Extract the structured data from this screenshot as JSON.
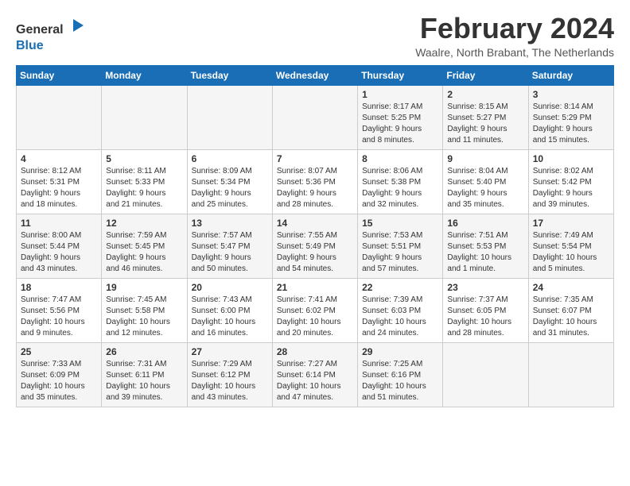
{
  "logo": {
    "line1": "General",
    "line2": "Blue"
  },
  "title": "February 2024",
  "location": "Waalre, North Brabant, The Netherlands",
  "weekdays": [
    "Sunday",
    "Monday",
    "Tuesday",
    "Wednesday",
    "Thursday",
    "Friday",
    "Saturday"
  ],
  "weeks": [
    [
      {
        "day": "",
        "info": ""
      },
      {
        "day": "",
        "info": ""
      },
      {
        "day": "",
        "info": ""
      },
      {
        "day": "",
        "info": ""
      },
      {
        "day": "1",
        "info": "Sunrise: 8:17 AM\nSunset: 5:25 PM\nDaylight: 9 hours\nand 8 minutes."
      },
      {
        "day": "2",
        "info": "Sunrise: 8:15 AM\nSunset: 5:27 PM\nDaylight: 9 hours\nand 11 minutes."
      },
      {
        "day": "3",
        "info": "Sunrise: 8:14 AM\nSunset: 5:29 PM\nDaylight: 9 hours\nand 15 minutes."
      }
    ],
    [
      {
        "day": "4",
        "info": "Sunrise: 8:12 AM\nSunset: 5:31 PM\nDaylight: 9 hours\nand 18 minutes."
      },
      {
        "day": "5",
        "info": "Sunrise: 8:11 AM\nSunset: 5:33 PM\nDaylight: 9 hours\nand 21 minutes."
      },
      {
        "day": "6",
        "info": "Sunrise: 8:09 AM\nSunset: 5:34 PM\nDaylight: 9 hours\nand 25 minutes."
      },
      {
        "day": "7",
        "info": "Sunrise: 8:07 AM\nSunset: 5:36 PM\nDaylight: 9 hours\nand 28 minutes."
      },
      {
        "day": "8",
        "info": "Sunrise: 8:06 AM\nSunset: 5:38 PM\nDaylight: 9 hours\nand 32 minutes."
      },
      {
        "day": "9",
        "info": "Sunrise: 8:04 AM\nSunset: 5:40 PM\nDaylight: 9 hours\nand 35 minutes."
      },
      {
        "day": "10",
        "info": "Sunrise: 8:02 AM\nSunset: 5:42 PM\nDaylight: 9 hours\nand 39 minutes."
      }
    ],
    [
      {
        "day": "11",
        "info": "Sunrise: 8:00 AM\nSunset: 5:44 PM\nDaylight: 9 hours\nand 43 minutes."
      },
      {
        "day": "12",
        "info": "Sunrise: 7:59 AM\nSunset: 5:45 PM\nDaylight: 9 hours\nand 46 minutes."
      },
      {
        "day": "13",
        "info": "Sunrise: 7:57 AM\nSunset: 5:47 PM\nDaylight: 9 hours\nand 50 minutes."
      },
      {
        "day": "14",
        "info": "Sunrise: 7:55 AM\nSunset: 5:49 PM\nDaylight: 9 hours\nand 54 minutes."
      },
      {
        "day": "15",
        "info": "Sunrise: 7:53 AM\nSunset: 5:51 PM\nDaylight: 9 hours\nand 57 minutes."
      },
      {
        "day": "16",
        "info": "Sunrise: 7:51 AM\nSunset: 5:53 PM\nDaylight: 10 hours\nand 1 minute."
      },
      {
        "day": "17",
        "info": "Sunrise: 7:49 AM\nSunset: 5:54 PM\nDaylight: 10 hours\nand 5 minutes."
      }
    ],
    [
      {
        "day": "18",
        "info": "Sunrise: 7:47 AM\nSunset: 5:56 PM\nDaylight: 10 hours\nand 9 minutes."
      },
      {
        "day": "19",
        "info": "Sunrise: 7:45 AM\nSunset: 5:58 PM\nDaylight: 10 hours\nand 12 minutes."
      },
      {
        "day": "20",
        "info": "Sunrise: 7:43 AM\nSunset: 6:00 PM\nDaylight: 10 hours\nand 16 minutes."
      },
      {
        "day": "21",
        "info": "Sunrise: 7:41 AM\nSunset: 6:02 PM\nDaylight: 10 hours\nand 20 minutes."
      },
      {
        "day": "22",
        "info": "Sunrise: 7:39 AM\nSunset: 6:03 PM\nDaylight: 10 hours\nand 24 minutes."
      },
      {
        "day": "23",
        "info": "Sunrise: 7:37 AM\nSunset: 6:05 PM\nDaylight: 10 hours\nand 28 minutes."
      },
      {
        "day": "24",
        "info": "Sunrise: 7:35 AM\nSunset: 6:07 PM\nDaylight: 10 hours\nand 31 minutes."
      }
    ],
    [
      {
        "day": "25",
        "info": "Sunrise: 7:33 AM\nSunset: 6:09 PM\nDaylight: 10 hours\nand 35 minutes."
      },
      {
        "day": "26",
        "info": "Sunrise: 7:31 AM\nSunset: 6:11 PM\nDaylight: 10 hours\nand 39 minutes."
      },
      {
        "day": "27",
        "info": "Sunrise: 7:29 AM\nSunset: 6:12 PM\nDaylight: 10 hours\nand 43 minutes."
      },
      {
        "day": "28",
        "info": "Sunrise: 7:27 AM\nSunset: 6:14 PM\nDaylight: 10 hours\nand 47 minutes."
      },
      {
        "day": "29",
        "info": "Sunrise: 7:25 AM\nSunset: 6:16 PM\nDaylight: 10 hours\nand 51 minutes."
      },
      {
        "day": "",
        "info": ""
      },
      {
        "day": "",
        "info": ""
      }
    ]
  ]
}
